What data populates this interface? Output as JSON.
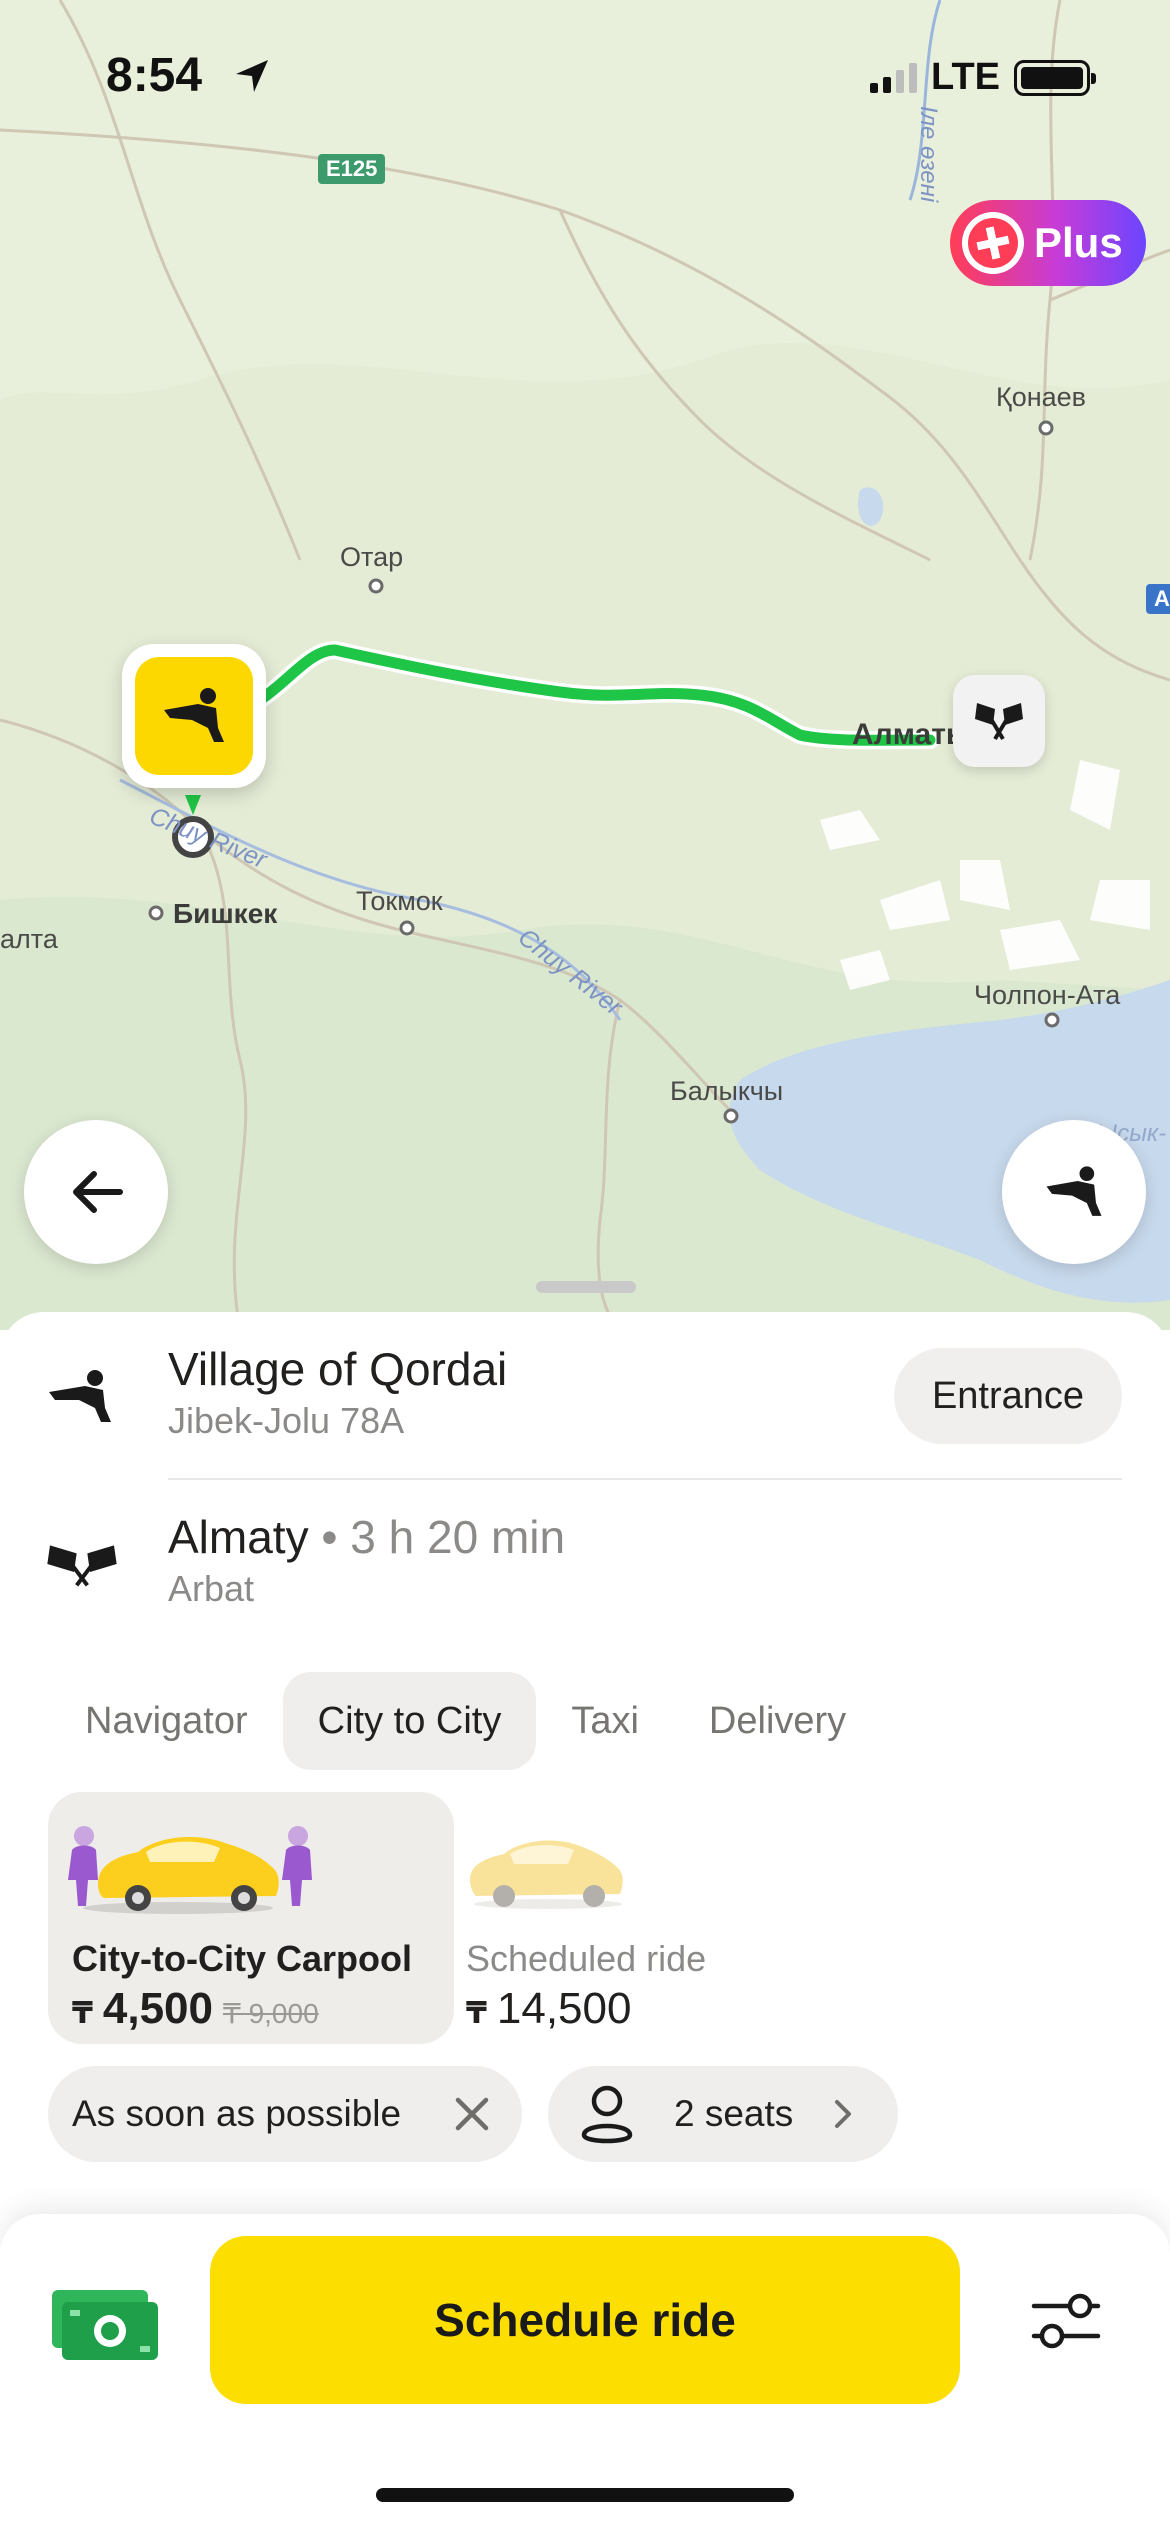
{
  "status_bar": {
    "time": "8:54",
    "network": "LTE"
  },
  "map": {
    "road_shield": "E125",
    "labels": {
      "otar": "Отар",
      "konaev": "Қонаев",
      "almaty": "Алматы",
      "bishkek": "Бишкек",
      "tokmok": "Токмок",
      "cholpon_ata": "Чолпон-Ата",
      "balykchy": "Балыкчы",
      "alta": "алта",
      "chuy_river_1": "Chuy River",
      "chuy_river_2": "Chuy River",
      "ile_ozeni": "Іле өзені",
      "issyk": "Ысык-",
      "a_shield": "A"
    },
    "route_color": "#1fc546"
  },
  "plus_badge": {
    "label": "Plus"
  },
  "sheet": {
    "from": {
      "title": "Village of Qordai",
      "subtitle": "Jibek-Jolu 78A",
      "entrance_label": "Entrance"
    },
    "to": {
      "title": "Almaty",
      "eta": "3 h 20 min",
      "subtitle": "Arbat"
    },
    "tabs": [
      "Navigator",
      "City to City",
      "Taxi",
      "Delivery"
    ],
    "active_tab": "City to City",
    "tariffs": [
      {
        "name": "City-to-City Carpool",
        "currency": "₸",
        "price": "4,500",
        "old_price": "₸ 9,000",
        "selected": true
      },
      {
        "name": "Scheduled ride",
        "currency": "₸",
        "price": "14,500",
        "selected": false
      }
    ],
    "time_chip": "As soon as possible",
    "seats_chip": "2 seats",
    "primary_button": "Schedule ride"
  },
  "colors": {
    "accent_yellow": "#fcde00",
    "route_green": "#1fc546"
  }
}
